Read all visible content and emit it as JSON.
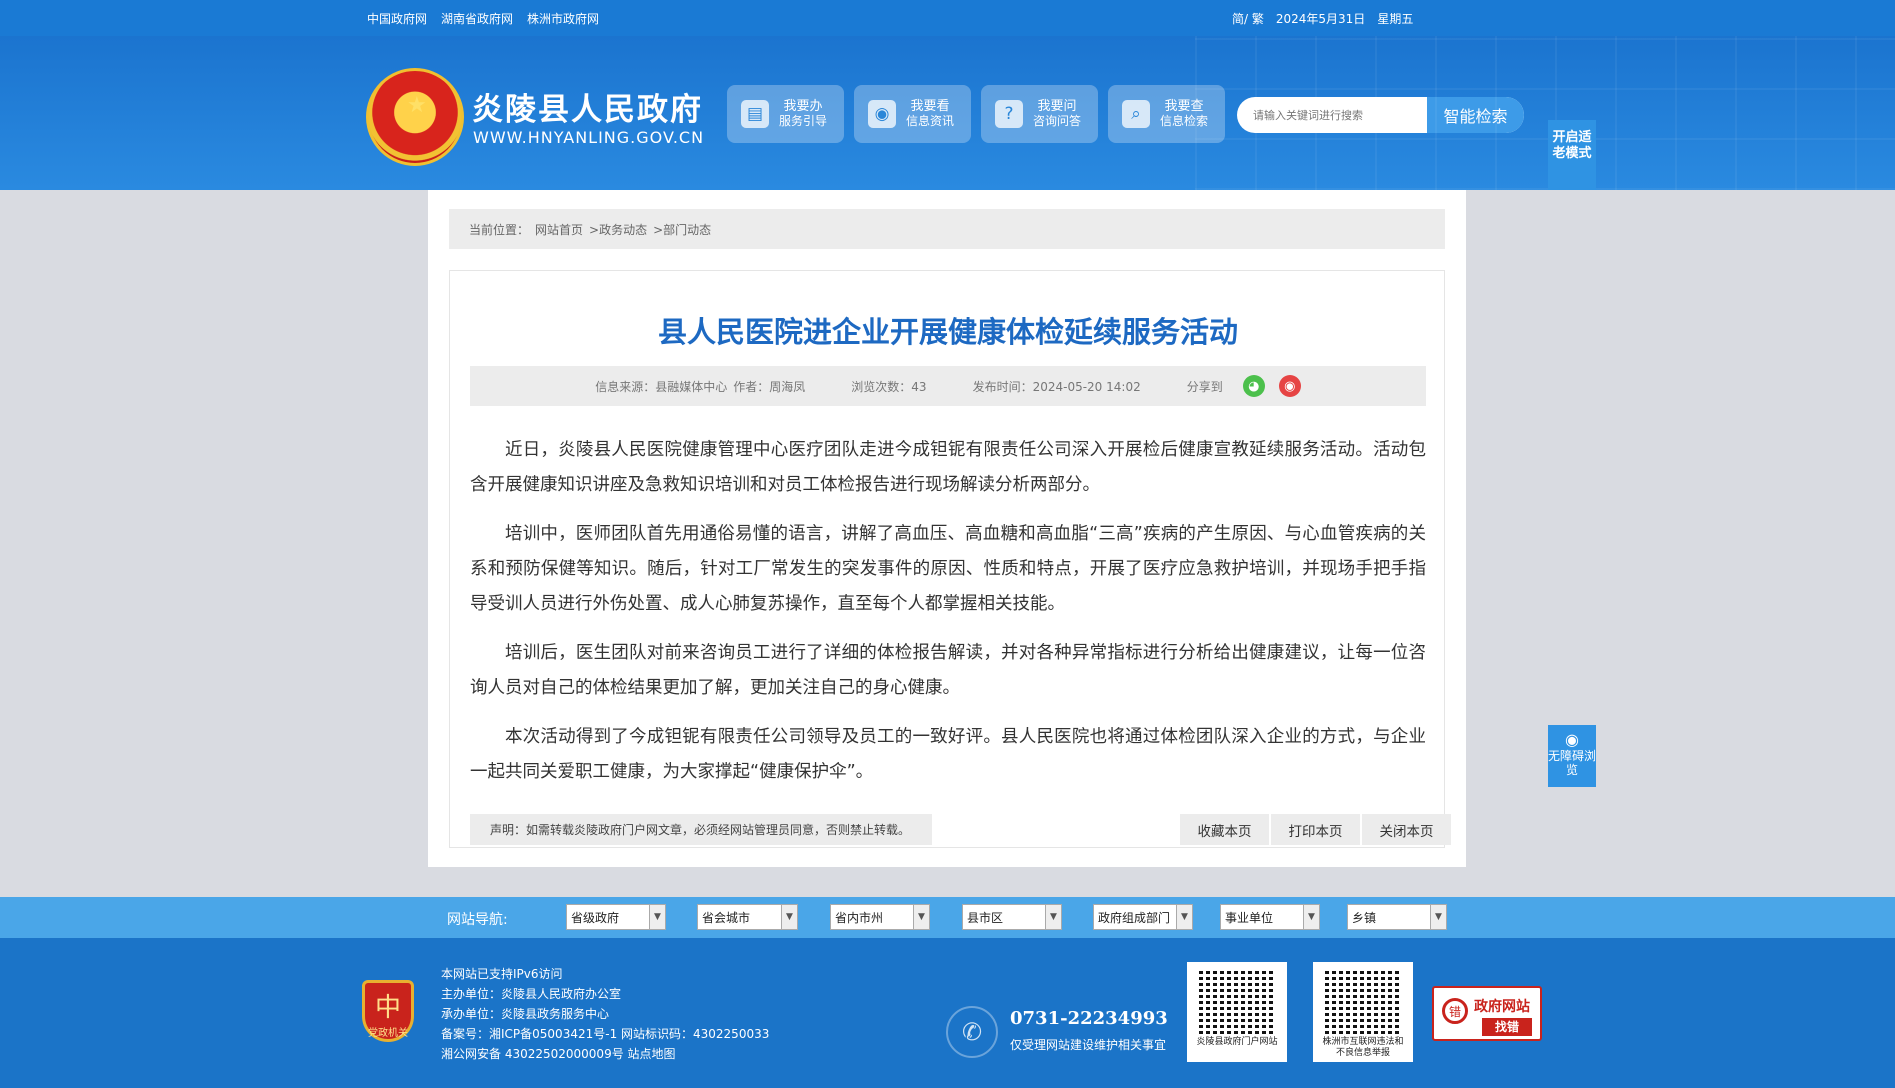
{
  "topbar": {
    "links": [
      "中国政府网",
      "湖南省政府网",
      "株洲市政府网"
    ],
    "lang": "简/ 繁",
    "date": "2024年5月31日",
    "weekday": "星期五"
  },
  "header": {
    "title": "炎陵县人民政府",
    "url": "WWW.HNYANLING.GOV.CN",
    "quick": [
      {
        "icon": "document-icon",
        "line1": "我要办",
        "line2": "服务引导"
      },
      {
        "icon": "eye-icon",
        "line1": "我要看",
        "line2": "信息资讯"
      },
      {
        "icon": "question-icon",
        "line1": "我要问",
        "line2": "咨询问答"
      },
      {
        "icon": "search-icon",
        "line1": "我要查",
        "line2": "信息检索"
      }
    ],
    "search_placeholder": "请输入关键词进行搜索",
    "search_button": "智能检索",
    "elder_mode": "开启适老模式"
  },
  "breadcrumb": {
    "label": "当前位置：",
    "items": [
      "网站首页",
      ">政务动态",
      ">部门动态"
    ]
  },
  "article": {
    "title": "县人民医院进企业开展健康体检延续服务活动",
    "source": "信息来源：县融媒体中心",
    "author": "作者：周海凤",
    "views": "浏览次数：43",
    "published": "发布时间：2024-05-20 14:02",
    "share": "分享到",
    "paragraphs": [
      "近日，炎陵县人民医院健康管理中心医疗团队走进今成钽铌有限责任公司深入开展检后健康宣教延续服务活动。活动包含开展健康知识讲座及急救知识培训和对员工体检报告进行现场解读分析两部分。",
      "培训中，医师团队首先用通俗易懂的语言，讲解了高血压、高血糖和高血脂“三高”疾病的产生原因、与心血管疾病的关系和预防保健等知识。随后，针对工厂常发生的突发事件的原因、性质和特点，开展了医疗应急救护培训，并现场手把手指导受训人员进行外伤处置、成人心肺复苏操作，直至每个人都掌握相关技能。",
      "培训后，医生团队对前来咨询员工进行了详细的体检报告解读，并对各种异常指标进行分析给出健康建议，让每一位咨询人员对自己的体检结果更加了解，更加关注自己的身心健康。",
      "本次活动得到了今成钽铌有限责任公司领导及员工的一致好评。县人民医院也将通过体检团队深入企业的方式，与企业一起共同关爱职工健康，为大家撑起“健康保护伞”。"
    ],
    "declaration": "声明：如需转载炎陵政府门户网文章，必须经网站管理员同意，否则禁止转载。",
    "actions": [
      "收藏本页",
      "打印本页",
      "关闭本页"
    ]
  },
  "accessibility": "无障碍浏览",
  "site_nav": {
    "label": "网站导航:",
    "selects": [
      "省级政府",
      "省会城市",
      "省内市州",
      "县市区",
      "政府组成部门",
      "事业单位",
      "乡镇"
    ]
  },
  "footer": {
    "badge": "党政机关",
    "lines": [
      "本网站已支持IPv6访问",
      "主办单位：炎陵县人民政府办公室",
      "承办单位：炎陵县政务服务中心",
      "备案号：湘ICP备05003421号-1 网站标识码：4302250033",
      "湘公网安备 43022502000009号 站点地图"
    ],
    "phone": "0731-22234993",
    "phone_note": "仅受理网站建设维护相关事宜",
    "qr1_caption": "炎陵县政府门户网站",
    "qr2_caption": "株洲市互联网违法和不良信息举报",
    "find_title": "政府网站",
    "find_sub": "找错"
  }
}
